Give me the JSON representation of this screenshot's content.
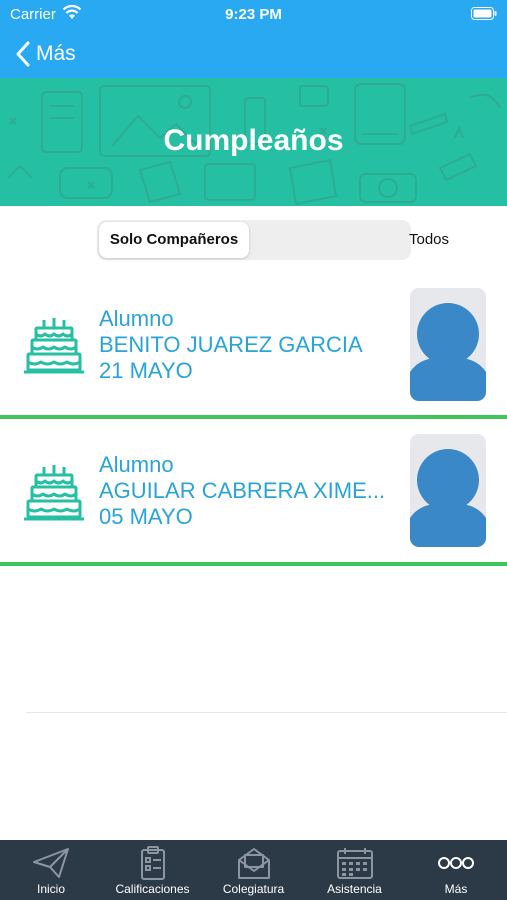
{
  "status": {
    "carrier": "Carrier",
    "time": "9:23 PM"
  },
  "nav": {
    "back_label": "Más"
  },
  "banner": {
    "title": "Cumpleaños"
  },
  "segment": {
    "active_label": "Solo Compañeros",
    "inactive_label": "Todos"
  },
  "students": [
    {
      "role": "Alumno",
      "name": "BENITO JUAREZ GARCIA",
      "date": "21 MAYO"
    },
    {
      "role": "Alumno",
      "name": "AGUILAR CABRERA XIME...",
      "date": "05 MAYO"
    }
  ],
  "tabs": [
    {
      "label": "Inicio",
      "icon": "paper-plane-icon"
    },
    {
      "label": "Calificaciones",
      "icon": "clipboard-list-icon"
    },
    {
      "label": "Colegiatura",
      "icon": "envelope-icon"
    },
    {
      "label": "Asistencia",
      "icon": "calendar-icon"
    },
    {
      "label": "Más",
      "icon": "more-dots-icon"
    }
  ],
  "colors": {
    "nav": "#29a9f1",
    "banner": "#25bfa3",
    "accent_text": "#2aa4d8",
    "separator": "#3fc55a",
    "tab_bar": "#2c3a47",
    "avatar": "#3a88c8"
  }
}
